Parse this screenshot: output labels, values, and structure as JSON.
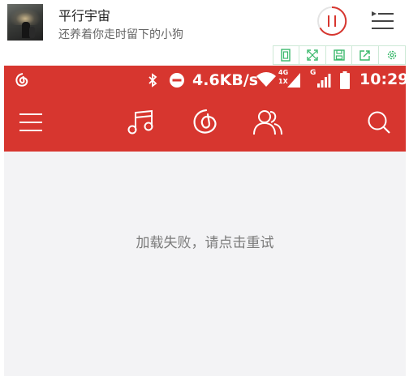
{
  "player": {
    "title": "平行宇宙",
    "subtitle": "还养着你走时留下的小狗",
    "accent_color": "#d7362f",
    "pause_icon": "pause-icon",
    "playlist_icon": "playlist-icon"
  },
  "toolstrip": {
    "icons": [
      "fit-screen-icon",
      "fullscreen-icon",
      "save-icon",
      "share-icon",
      "settings-icon"
    ],
    "color": "#3ab86b"
  },
  "status_bar": {
    "speed": "4.6KB/s",
    "net_4g": "4G",
    "net_1x": "1X",
    "net_g": "G",
    "time": "10:29"
  },
  "nav": {
    "background": "#d7362f",
    "icons": [
      "menu-icon",
      "music-icon",
      "netease-logo-icon",
      "friends-icon",
      "search-icon"
    ]
  },
  "content": {
    "error_message": "加载失败，请点击重试",
    "background": "#f3f3f5"
  }
}
